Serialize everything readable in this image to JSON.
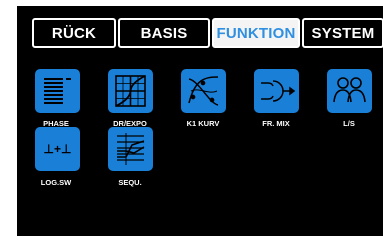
{
  "tabs": [
    {
      "label": "RÜCK",
      "active": false
    },
    {
      "label": "BASIS",
      "active": false
    },
    {
      "label": "FUNKTION",
      "active": true
    },
    {
      "label": "SYSTEM",
      "active": false
    }
  ],
  "functions": [
    {
      "label": "PHASE",
      "icon": "phase-list-icon"
    },
    {
      "label": "DR/EXPO",
      "icon": "dr-expo-grid-icon"
    },
    {
      "label": "K1 KURV",
      "icon": "curve-icon"
    },
    {
      "label": "FR. MIX",
      "icon": "mix-arrow-icon"
    },
    {
      "label": "L/S",
      "icon": "two-users-icon"
    },
    {
      "label": "LOG.SW",
      "icon": "logic-switch-icon"
    },
    {
      "label": "SEQU.",
      "icon": "sequence-icon"
    }
  ],
  "colors": {
    "screen_bg": "#000000",
    "tile_blue": "#1a7fd6",
    "active_tab_text": "#2f8fe0"
  }
}
